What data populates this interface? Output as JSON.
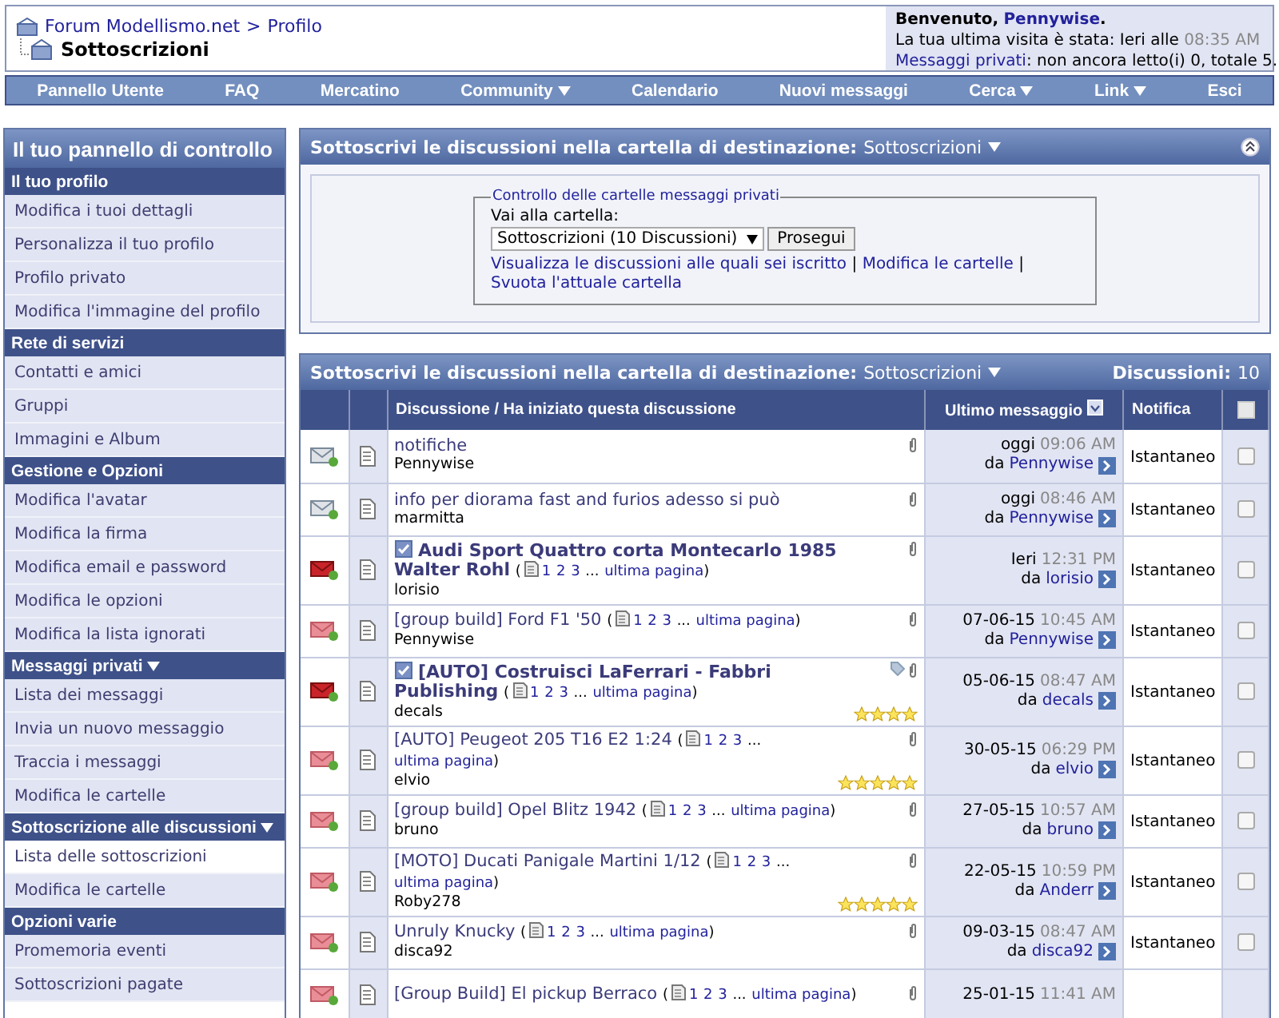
{
  "breadcrumb": {
    "parent": "Forum Modellismo.net",
    "separator": ">",
    "section": "Profilo",
    "current": "Sottoscrizioni"
  },
  "welcome": {
    "greeting": "Benvenuto,",
    "user": "Pennywise",
    "end": ".",
    "visit_label": "La tua ultima visita è stata: Ieri alle",
    "visit_time": "08:35 AM",
    "pm_link": "Messaggi privati",
    "pm_text": ": non ancora letto(i) 0, totale 5."
  },
  "nav": [
    {
      "label": "Pannello Utente",
      "has_menu": false
    },
    {
      "label": "FAQ",
      "has_menu": false
    },
    {
      "label": "Mercatino",
      "has_menu": false
    },
    {
      "label": "Community",
      "has_menu": true
    },
    {
      "label": "Calendario",
      "has_menu": false
    },
    {
      "label": "Nuovi messaggi",
      "has_menu": false
    },
    {
      "label": "Cerca",
      "has_menu": true
    },
    {
      "label": "Link",
      "has_menu": true
    },
    {
      "label": "Esci",
      "has_menu": false
    }
  ],
  "sidebar": {
    "title": "Il tuo pannello di controllo",
    "sections": [
      {
        "title": "Il tuo profilo",
        "has_menu": false,
        "items": [
          {
            "label": "Modifica i tuoi dettagli",
            "selected": false
          },
          {
            "label": "Personalizza il tuo profilo",
            "selected": false
          },
          {
            "label": "Profilo privato",
            "selected": false
          },
          {
            "label": "Modifica l'immagine del profilo",
            "selected": false
          }
        ]
      },
      {
        "title": "Rete di servizi",
        "has_menu": false,
        "items": [
          {
            "label": "Contatti e amici",
            "selected": false
          },
          {
            "label": "Gruppi",
            "selected": false
          },
          {
            "label": "Immagini e Album",
            "selected": false
          }
        ]
      },
      {
        "title": "Gestione e Opzioni",
        "has_menu": false,
        "items": [
          {
            "label": "Modifica l'avatar",
            "selected": false
          },
          {
            "label": "Modifica la firma",
            "selected": false
          },
          {
            "label": "Modifica email e password",
            "selected": false
          },
          {
            "label": "Modifica le opzioni",
            "selected": false
          },
          {
            "label": "Modifica la lista ignorati",
            "selected": false
          }
        ]
      },
      {
        "title": "Messaggi privati",
        "has_menu": true,
        "items": [
          {
            "label": "Lista dei messaggi",
            "selected": false
          },
          {
            "label": "Invia un nuovo messaggio",
            "selected": false
          },
          {
            "label": "Traccia i messaggi",
            "selected": false
          },
          {
            "label": "Modifica le cartelle",
            "selected": false
          }
        ]
      },
      {
        "title": "Sottoscrizione alle discussioni",
        "has_menu": true,
        "items": [
          {
            "label": "Lista delle sottoscrizioni",
            "selected": true
          },
          {
            "label": "Modifica le cartelle",
            "selected": false
          }
        ]
      },
      {
        "title": "Opzioni varie",
        "has_menu": false,
        "items": [
          {
            "label": "Promemoria eventi",
            "selected": false
          },
          {
            "label": "Sottoscrizioni pagate",
            "selected": false
          }
        ]
      }
    ]
  },
  "folder_panel": {
    "title": "Sottoscrivi le discussioni nella cartella di destinazione:",
    "folder": "Sottoscrizioni",
    "legend": "Controllo delle cartelle messaggi privati",
    "label": "Vai alla cartella:",
    "select_value": "Sottoscrizioni (10 Discussioni)",
    "button": "Prosegui",
    "links": [
      "Visualizza le discussioni alle quali sei iscritto",
      "Modifica le cartelle",
      "Svuota l'attuale cartella"
    ],
    "separator": "|"
  },
  "threads_panel": {
    "title": "Sottoscrivi le discussioni nella cartella di destinazione:",
    "folder": "Sottoscrizioni",
    "count_label": "Discussioni:",
    "count": "10",
    "columns": {
      "discussion": "Discussione / Ha iniziato questa discussione",
      "last_post": "Ultimo messaggio",
      "notify": "Notifica"
    },
    "select_all_checked": false
  },
  "threads": [
    {
      "kind": "read",
      "title": "notifiche",
      "unread": false,
      "tagged": false,
      "author": "Pennywise",
      "date": "oggi",
      "time": "09:06 AM",
      "by_prefix": "da",
      "by": "Pennywise",
      "notify": "Istantaneo",
      "checked": false
    },
    {
      "kind": "read",
      "title": "info per diorama fast and furios adesso si può",
      "unread": false,
      "tagged": false,
      "author": "marmitta",
      "date": "oggi",
      "time": "08:46 AM",
      "by_prefix": "da",
      "by": "Pennywise",
      "notify": "Istantaneo",
      "checked": false
    },
    {
      "kind": "new",
      "title": "Audi Sport Quattro corta Montecarlo 1985 Walter Rohl",
      "unread": true,
      "tagged": false,
      "pages": {
        "open": "(",
        "links": [
          "1",
          "2",
          "3"
        ],
        "gap": "...",
        "last": "ultima pagina",
        "close": ")"
      },
      "author": "lorisio",
      "date": "Ieri",
      "time": "12:31 PM",
      "by_prefix": "da",
      "by": "lorisio",
      "notify": "Istantaneo",
      "checked": false
    },
    {
      "kind": "hot",
      "title": "[group build] Ford F1 '50",
      "unread": false,
      "tagged": false,
      "pages": {
        "open": "(",
        "links": [
          "1",
          "2",
          "3"
        ],
        "gap": "...",
        "last": "ultima pagina",
        "close": ")"
      },
      "author": "Pennywise",
      "date": "07-06-15",
      "time": "10:45 AM",
      "by_prefix": "da",
      "by": "Pennywise",
      "notify": "Istantaneo",
      "checked": false
    },
    {
      "kind": "new",
      "title": "[AUTO] Costruisci LaFerrari - Fabbri Publishing",
      "unread": true,
      "tagged": true,
      "pages": {
        "open": "(",
        "links": [
          "1",
          "2",
          "3"
        ],
        "gap": "...",
        "last": "ultima pagina",
        "close": ")"
      },
      "author": "decals",
      "stars": 4,
      "date": "05-06-15",
      "time": "08:47 AM",
      "by_prefix": "da",
      "by": "decals",
      "notify": "Istantaneo",
      "checked": false
    },
    {
      "kind": "hot",
      "title": "[AUTO] Peugeot 205 T16 E2 1:24",
      "unread": false,
      "tagged": false,
      "pages": {
        "open": "(",
        "links": [
          "1",
          "2",
          "3"
        ],
        "gap": "...",
        "last": "ultima pagina",
        "close": ")"
      },
      "author": "elvio",
      "stars": 5,
      "date": "30-05-15",
      "time": "06:29 PM",
      "by_prefix": "da",
      "by": "elvio",
      "notify": "Istantaneo",
      "checked": false
    },
    {
      "kind": "hot",
      "title": "[group build] Opel Blitz 1942",
      "unread": false,
      "tagged": false,
      "pages": {
        "open": "(",
        "links": [
          "1",
          "2",
          "3"
        ],
        "gap": "...",
        "last": "ultima pagina",
        "close": ")"
      },
      "author": "bruno",
      "date": "27-05-15",
      "time": "10:57 AM",
      "by_prefix": "da",
      "by": "bruno",
      "notify": "Istantaneo",
      "checked": false
    },
    {
      "kind": "hot",
      "title": "[MOTO] Ducati Panigale Martini 1/12",
      "unread": false,
      "tagged": false,
      "pages": {
        "open": "(",
        "links": [
          "1",
          "2",
          "3"
        ],
        "gap": "...",
        "last": "ultima pagina",
        "close": ")"
      },
      "author": "Roby278",
      "stars": 5,
      "date": "22-05-15",
      "time": "10:59 PM",
      "by_prefix": "da",
      "by": "Anderr",
      "notify": "Istantaneo",
      "checked": false
    },
    {
      "kind": "hot",
      "title": "Unruly Knucky",
      "unread": false,
      "tagged": false,
      "pages": {
        "open": "(",
        "links": [
          "1",
          "2",
          "3"
        ],
        "gap": "...",
        "last": "ultima pagina",
        "close": ")"
      },
      "author": "disca92",
      "date": "09-03-15",
      "time": "08:47 AM",
      "by_prefix": "da",
      "by": "disca92",
      "notify": "Istantaneo",
      "checked": false
    },
    {
      "kind": "hot",
      "title": "[Group Build] El pickup Berraco",
      "unread": false,
      "tagged": false,
      "pages": {
        "open": "(",
        "links": [
          "1",
          "2",
          "3"
        ],
        "gap": "...",
        "last": "ultima pagina",
        "close": ")"
      },
      "date": "25-01-15",
      "time": "11:41 AM"
    }
  ]
}
